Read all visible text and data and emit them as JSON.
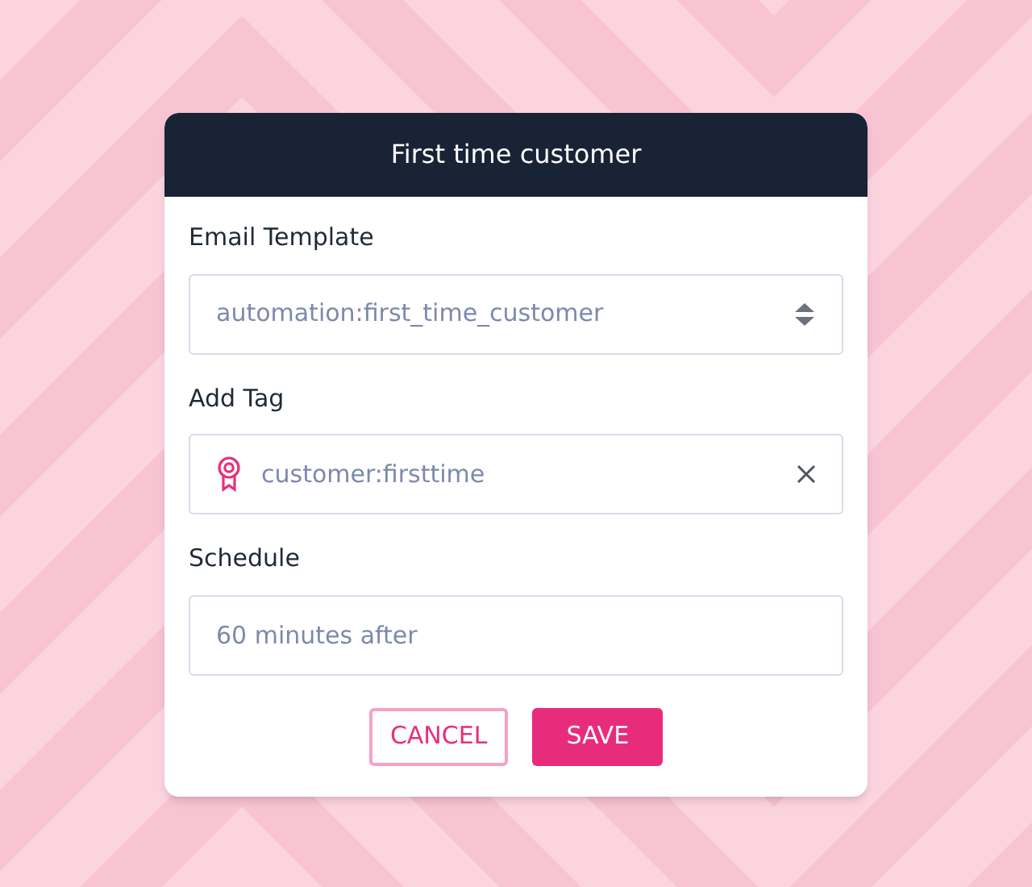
{
  "dialog": {
    "title": "First time customer",
    "fields": [
      {
        "kind": "select",
        "label": "Email Template",
        "value": "automation:first_time_customer"
      },
      {
        "kind": "tag",
        "label": "Add Tag",
        "value": "customer:firsttime"
      },
      {
        "kind": "text",
        "label": "Schedule",
        "value": "60 minutes after"
      }
    ],
    "buttons": [
      {
        "kind": "secondary",
        "label": "CANCEL"
      },
      {
        "kind": "primary",
        "label": "SAVE"
      }
    ]
  }
}
